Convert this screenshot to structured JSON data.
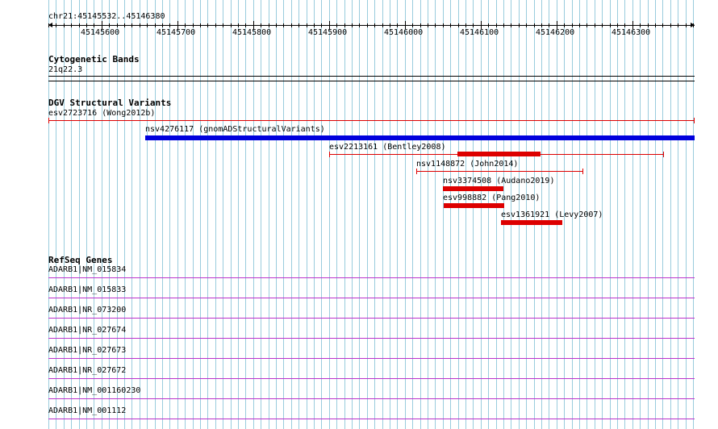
{
  "header": {
    "location": "chr21:45145532..45146380"
  },
  "ruler": {
    "ticks": [
      "45145600",
      "45145700",
      "45145800",
      "45145900",
      "45146000",
      "45146100",
      "45146200",
      "45146300"
    ]
  },
  "cytoband": {
    "title": "Cytogenetic Bands",
    "band": "21q22.3"
  },
  "dgv": {
    "title": "DGV Structural Variants",
    "features": [
      {
        "label": "esv2723716 (Wong2012b)",
        "color": "#dd0000"
      },
      {
        "label": "nsv4276117 (gnomADStructuralVariants)",
        "color": "#0000dd"
      },
      {
        "label": "esv2213161 (Bentley2008)",
        "color": "#dd0000"
      },
      {
        "label": "nsv1148872 (John2014)",
        "color": "#dd0000"
      },
      {
        "label": "nsv3374508 (Audano2019)",
        "color": "#dd0000"
      },
      {
        "label": "esv998882 (Pang2010)",
        "color": "#dd0000"
      },
      {
        "label": "esv1361921 (Levy2007)",
        "color": "#dd0000"
      }
    ]
  },
  "refseq": {
    "title": "RefSeq Genes",
    "color": "#bb33cc",
    "genes": [
      "ADARB1|NM_015834",
      "ADARB1|NM_015833",
      "ADARB1|NR_073200",
      "ADARB1|NR_027674",
      "ADARB1|NR_027673",
      "ADARB1|NR_027672",
      "ADARB1|NM_001160230",
      "ADARB1|NM_001112"
    ]
  },
  "colors": {
    "grid": "#99ccdd",
    "ruler": "#000000"
  }
}
